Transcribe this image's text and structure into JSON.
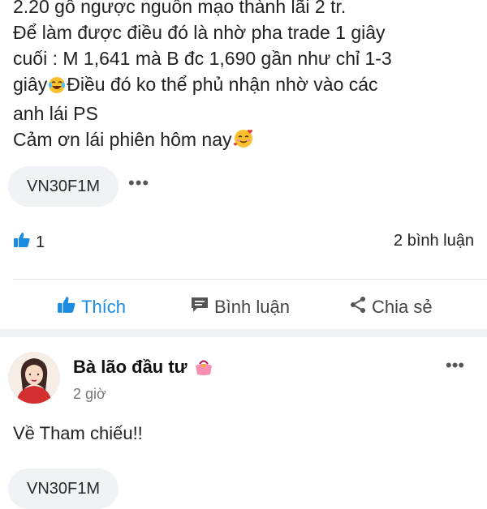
{
  "post": {
    "lines": [
      "2.20 gồ ngược nguồn mạo thành lãi 2 tr.",
      "Để làm được điều đó là nhờ pha trade 1 giây",
      "cuối : M 1,641 mà B đc 1,690 gần như chỉ 1-3",
      "giây",
      "Điều đó ko thể phủ nhận nhờ vào các",
      "anh lái PS",
      "Cảm ơn lái phiên hôm nay"
    ],
    "tag": "VN30F1M",
    "more_label": "•••",
    "like_count": "1",
    "comment_count": "2 bình luận"
  },
  "actions": {
    "like": "Thích",
    "comment": "Bình luận",
    "share": "Chia sẻ"
  },
  "next_post": {
    "author": "Bà lão đầu tư",
    "time": "2 giờ",
    "menu_label": "•••",
    "text": "Về Tham chiếu!!",
    "tag": "VN30F1M"
  },
  "icons": {
    "like": "thumbs-up-icon",
    "comment": "comment-bubble-icon",
    "share": "share-icon",
    "laugh": "tears-of-joy-emoji",
    "love": "smiling-hearts-emoji",
    "purse": "purse-emoji"
  },
  "colors": {
    "accent": "#1b8be0",
    "chip_bg": "#f0f2f5",
    "band": "#eef0f2"
  }
}
